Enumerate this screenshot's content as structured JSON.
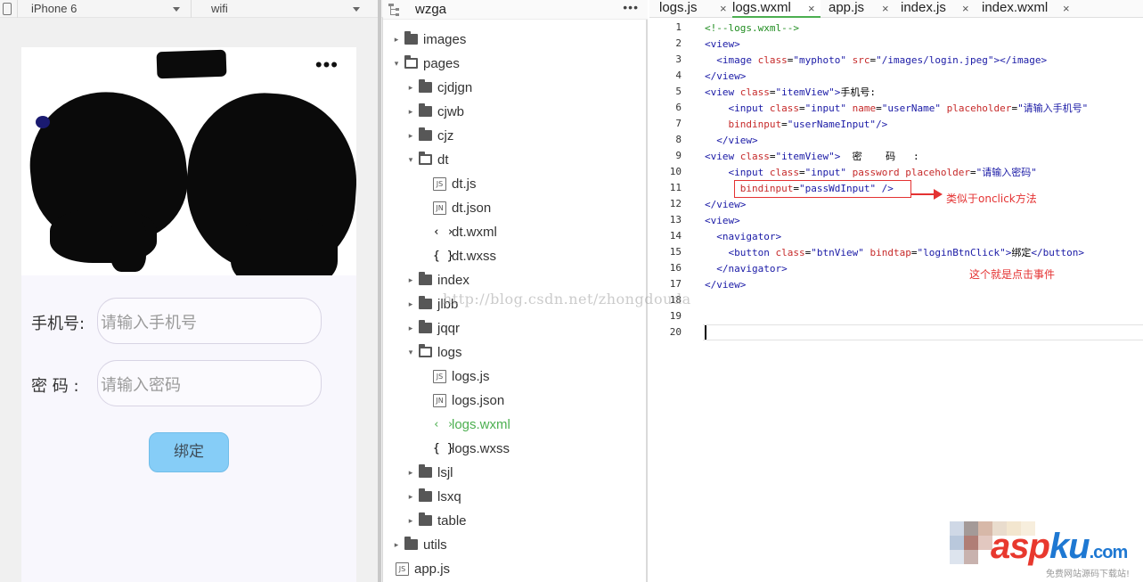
{
  "simulator": {
    "device": "iPhone 6",
    "network": "wifi",
    "phone": {
      "form": {
        "phone_label": "手机号:",
        "phone_placeholder": "请输入手机号",
        "password_label": "密  码 :",
        "password_placeholder": "请输入密码",
        "submit_label": "绑定"
      }
    }
  },
  "explorer": {
    "project": "wzga",
    "tree": [
      {
        "name": "images",
        "type": "folder",
        "depth": 0,
        "expanded": false
      },
      {
        "name": "pages",
        "type": "folder",
        "depth": 0,
        "expanded": true
      },
      {
        "name": "cjdjgn",
        "type": "folder",
        "depth": 1,
        "expanded": false
      },
      {
        "name": "cjwb",
        "type": "folder",
        "depth": 1,
        "expanded": false
      },
      {
        "name": "cjz",
        "type": "folder",
        "depth": 1,
        "expanded": false
      },
      {
        "name": "dt",
        "type": "folder",
        "depth": 1,
        "expanded": true
      },
      {
        "name": "dt.js",
        "type": "js",
        "depth": 2
      },
      {
        "name": "dt.json",
        "type": "json",
        "depth": 2
      },
      {
        "name": "dt.wxml",
        "type": "wxml",
        "depth": 2
      },
      {
        "name": "dt.wxss",
        "type": "wxss",
        "depth": 2
      },
      {
        "name": "index",
        "type": "folder",
        "depth": 1,
        "expanded": false
      },
      {
        "name": "jlbb",
        "type": "folder",
        "depth": 1,
        "expanded": false
      },
      {
        "name": "jqqr",
        "type": "folder",
        "depth": 1,
        "expanded": false
      },
      {
        "name": "logs",
        "type": "folder",
        "depth": 1,
        "expanded": true
      },
      {
        "name": "logs.js",
        "type": "js",
        "depth": 2
      },
      {
        "name": "logs.json",
        "type": "json",
        "depth": 2
      },
      {
        "name": "logs.wxml",
        "type": "wxml",
        "depth": 2,
        "active": true
      },
      {
        "name": "logs.wxss",
        "type": "wxss",
        "depth": 2
      },
      {
        "name": "lsjl",
        "type": "folder",
        "depth": 1,
        "expanded": false
      },
      {
        "name": "lsxq",
        "type": "folder",
        "depth": 1,
        "expanded": false
      },
      {
        "name": "table",
        "type": "folder",
        "depth": 1,
        "expanded": false
      },
      {
        "name": "utils",
        "type": "folder",
        "depth": 0,
        "expanded": false
      },
      {
        "name": "app.js",
        "type": "js",
        "depth": 0
      }
    ]
  },
  "editor": {
    "tabs": [
      {
        "label": "logs.js",
        "active": false
      },
      {
        "label": "logs.wxml",
        "active": true
      },
      {
        "label": "app.js",
        "active": false
      },
      {
        "label": "index.js",
        "active": false
      },
      {
        "label": "index.wxml",
        "active": false
      }
    ],
    "line_numbers": [
      "1",
      "2",
      "3",
      "4",
      "5",
      "6",
      "7",
      "8",
      "9",
      "10",
      "11",
      "12",
      "13",
      "14",
      "15",
      "16",
      "17",
      "18",
      "19",
      "20"
    ],
    "lines": [
      [
        {
          "t": "<!--logs.wxml-->",
          "c": "com"
        }
      ],
      [
        {
          "t": "<view>",
          "c": "tag"
        }
      ],
      [
        {
          "t": "  <image ",
          "c": "tag"
        },
        {
          "t": "class",
          "c": "att"
        },
        {
          "t": "=",
          "c": "txt"
        },
        {
          "t": "\"myphoto\"",
          "c": "val"
        },
        {
          "t": " src",
          "c": "att"
        },
        {
          "t": "=",
          "c": "txt"
        },
        {
          "t": "\"/images/login.jpeg\"",
          "c": "val"
        },
        {
          "t": "></image>",
          "c": "tag"
        }
      ],
      [
        {
          "t": "</view>",
          "c": "tag"
        }
      ],
      [
        {
          "t": "<view ",
          "c": "tag"
        },
        {
          "t": "class",
          "c": "att"
        },
        {
          "t": "=",
          "c": "txt"
        },
        {
          "t": "\"itemView\"",
          "c": "val"
        },
        {
          "t": ">",
          "c": "tag"
        },
        {
          "t": "手机号:",
          "c": "txt"
        }
      ],
      [
        {
          "t": "    <input ",
          "c": "tag"
        },
        {
          "t": "class",
          "c": "att"
        },
        {
          "t": "=",
          "c": "txt"
        },
        {
          "t": "\"input\"",
          "c": "val"
        },
        {
          "t": " name",
          "c": "att"
        },
        {
          "t": "=",
          "c": "txt"
        },
        {
          "t": "\"userName\"",
          "c": "val"
        },
        {
          "t": " placeholder",
          "c": "att"
        },
        {
          "t": "=",
          "c": "txt"
        },
        {
          "t": "\"请输入手机号\"",
          "c": "val"
        }
      ],
      [
        {
          "t": "    bindinput",
          "c": "att"
        },
        {
          "t": "=",
          "c": "txt"
        },
        {
          "t": "\"userNameInput\"",
          "c": "val"
        },
        {
          "t": "/>",
          "c": "tag"
        }
      ],
      [
        {
          "t": "  </view>",
          "c": "tag"
        }
      ],
      [
        {
          "t": "<view ",
          "c": "tag"
        },
        {
          "t": "class",
          "c": "att"
        },
        {
          "t": "=",
          "c": "txt"
        },
        {
          "t": "\"itemView\"",
          "c": "val"
        },
        {
          "t": ">",
          "c": "tag"
        },
        {
          "t": "  密    码   :",
          "c": "txt"
        }
      ],
      [
        {
          "t": "    <input ",
          "c": "tag"
        },
        {
          "t": "class",
          "c": "att"
        },
        {
          "t": "=",
          "c": "txt"
        },
        {
          "t": "\"input\"",
          "c": "val"
        },
        {
          "t": " password placeholder",
          "c": "att"
        },
        {
          "t": "=",
          "c": "txt"
        },
        {
          "t": "\"请输入密码\"",
          "c": "val"
        }
      ],
      [
        {
          "t": "      bindinput",
          "c": "att"
        },
        {
          "t": "=",
          "c": "txt"
        },
        {
          "t": "\"passWdInput\"",
          "c": "val"
        },
        {
          "t": " />",
          "c": "tag"
        }
      ],
      [
        {
          "t": "</view>",
          "c": "tag"
        }
      ],
      [
        {
          "t": "<view>",
          "c": "tag"
        }
      ],
      [
        {
          "t": "  <navigator>",
          "c": "tag"
        }
      ],
      [
        {
          "t": "    <button ",
          "c": "tag"
        },
        {
          "t": "class",
          "c": "att"
        },
        {
          "t": "=",
          "c": "txt"
        },
        {
          "t": "\"btnView\"",
          "c": "val"
        },
        {
          "t": " bindtap",
          "c": "att"
        },
        {
          "t": "=",
          "c": "txt"
        },
        {
          "t": "\"loginBtnClick\"",
          "c": "val"
        },
        {
          "t": ">",
          "c": "tag"
        },
        {
          "t": "绑定",
          "c": "txt"
        },
        {
          "t": "</button>",
          "c": "tag"
        }
      ],
      [
        {
          "t": "  </navigator>",
          "c": "tag"
        }
      ],
      [
        {
          "t": "</view>",
          "c": "tag"
        }
      ],
      [],
      [],
      []
    ],
    "annotations": {
      "onclick_note": "类似于onclick方法",
      "event_note": "这个就是点击事件"
    }
  },
  "watermark": "http://blog.csdn.net/zhongdouda",
  "logo": {
    "asp": "asp",
    "ku": "ku",
    "com": ".com",
    "tagline": "免费网站源码下载站!"
  },
  "colors": {
    "accent_green": "#4caf50",
    "annotation_red": "#e43232",
    "button_blue": "#86cdf7",
    "code_tag": "#1a1aa6",
    "code_attr": "#c62a2a",
    "code_comment": "#218d21"
  },
  "icons": [
    "device-icon",
    "caret-down-icon",
    "folder-icon",
    "folder-open-icon",
    "js-file-icon",
    "json-file-icon",
    "wxml-file-icon",
    "wxss-file-icon",
    "more-icon",
    "close-icon",
    "hierarchy-icon"
  ]
}
